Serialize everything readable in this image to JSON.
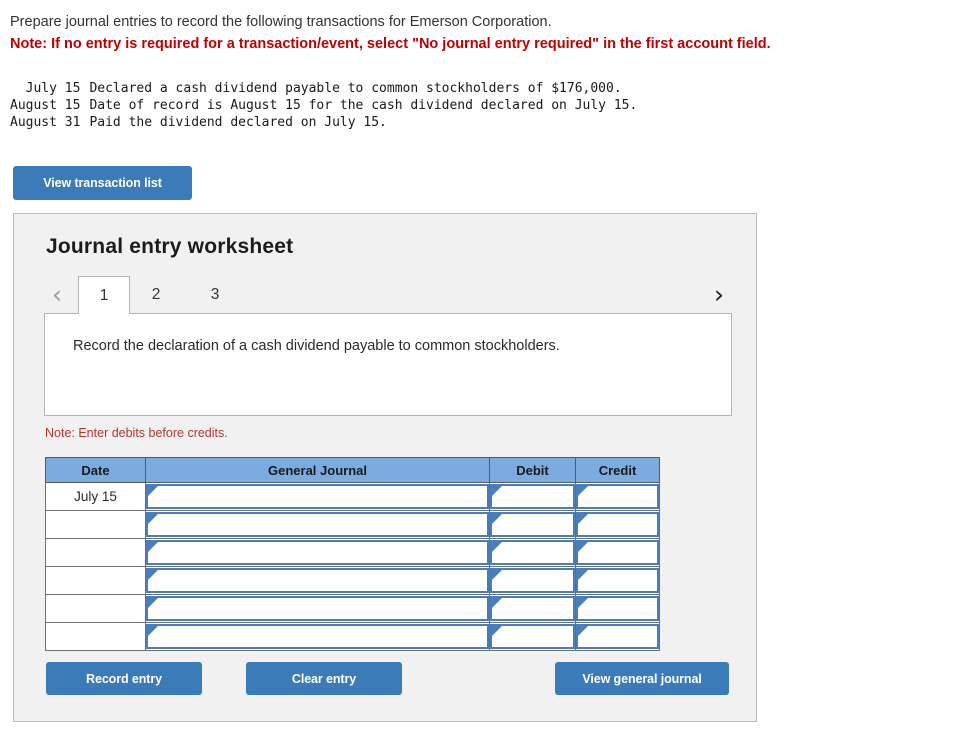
{
  "problem": {
    "instruction": "Prepare journal entries to record the following transactions for Emerson Corporation.",
    "note": "Note: If no entry is required for a transaction/event, select \"No journal entry required\" in the first account field."
  },
  "transactions": [
    {
      "date": "July 15",
      "description": "Declared a cash dividend payable to common stockholders of $176,000."
    },
    {
      "date": "August 15",
      "description": "Date of record is August 15 for the cash dividend declared on July 15."
    },
    {
      "date": "August 31",
      "description": "Paid the dividend declared on July 15."
    }
  ],
  "toolbar": {
    "view_transaction_list_label": "View transaction list"
  },
  "worksheet": {
    "title": "Journal entry worksheet",
    "tabs": [
      {
        "label": "1",
        "active": true
      },
      {
        "label": "2",
        "active": false
      },
      {
        "label": "3",
        "active": false
      }
    ],
    "prev_chevron": "‹",
    "next_chevron": "›",
    "instruction": "Record the declaration of a cash dividend payable to common stockholders.",
    "debits_note": "Note: Enter debits before credits.",
    "table": {
      "columns": [
        "Date",
        "General Journal",
        "Debit",
        "Credit"
      ],
      "rows": [
        {
          "date": "July 15",
          "general_journal": "",
          "debit": "",
          "credit": ""
        },
        {
          "date": "",
          "general_journal": "",
          "debit": "",
          "credit": ""
        },
        {
          "date": "",
          "general_journal": "",
          "debit": "",
          "credit": ""
        },
        {
          "date": "",
          "general_journal": "",
          "debit": "",
          "credit": ""
        },
        {
          "date": "",
          "general_journal": "",
          "debit": "",
          "credit": ""
        },
        {
          "date": "",
          "general_journal": "",
          "debit": "",
          "credit": ""
        }
      ]
    },
    "actions": {
      "record_entry_label": "Record entry",
      "clear_entry_label": "Clear entry",
      "view_general_journal_label": "View general journal"
    }
  },
  "colors": {
    "button_blue": "#3B7CB8",
    "table_header_blue": "#7CACDF",
    "input_border_blue": "#4A7EBB",
    "note_red": "#C00000",
    "debits_note_red": "#B5372E",
    "panel_gray": "#F1F1F1"
  }
}
